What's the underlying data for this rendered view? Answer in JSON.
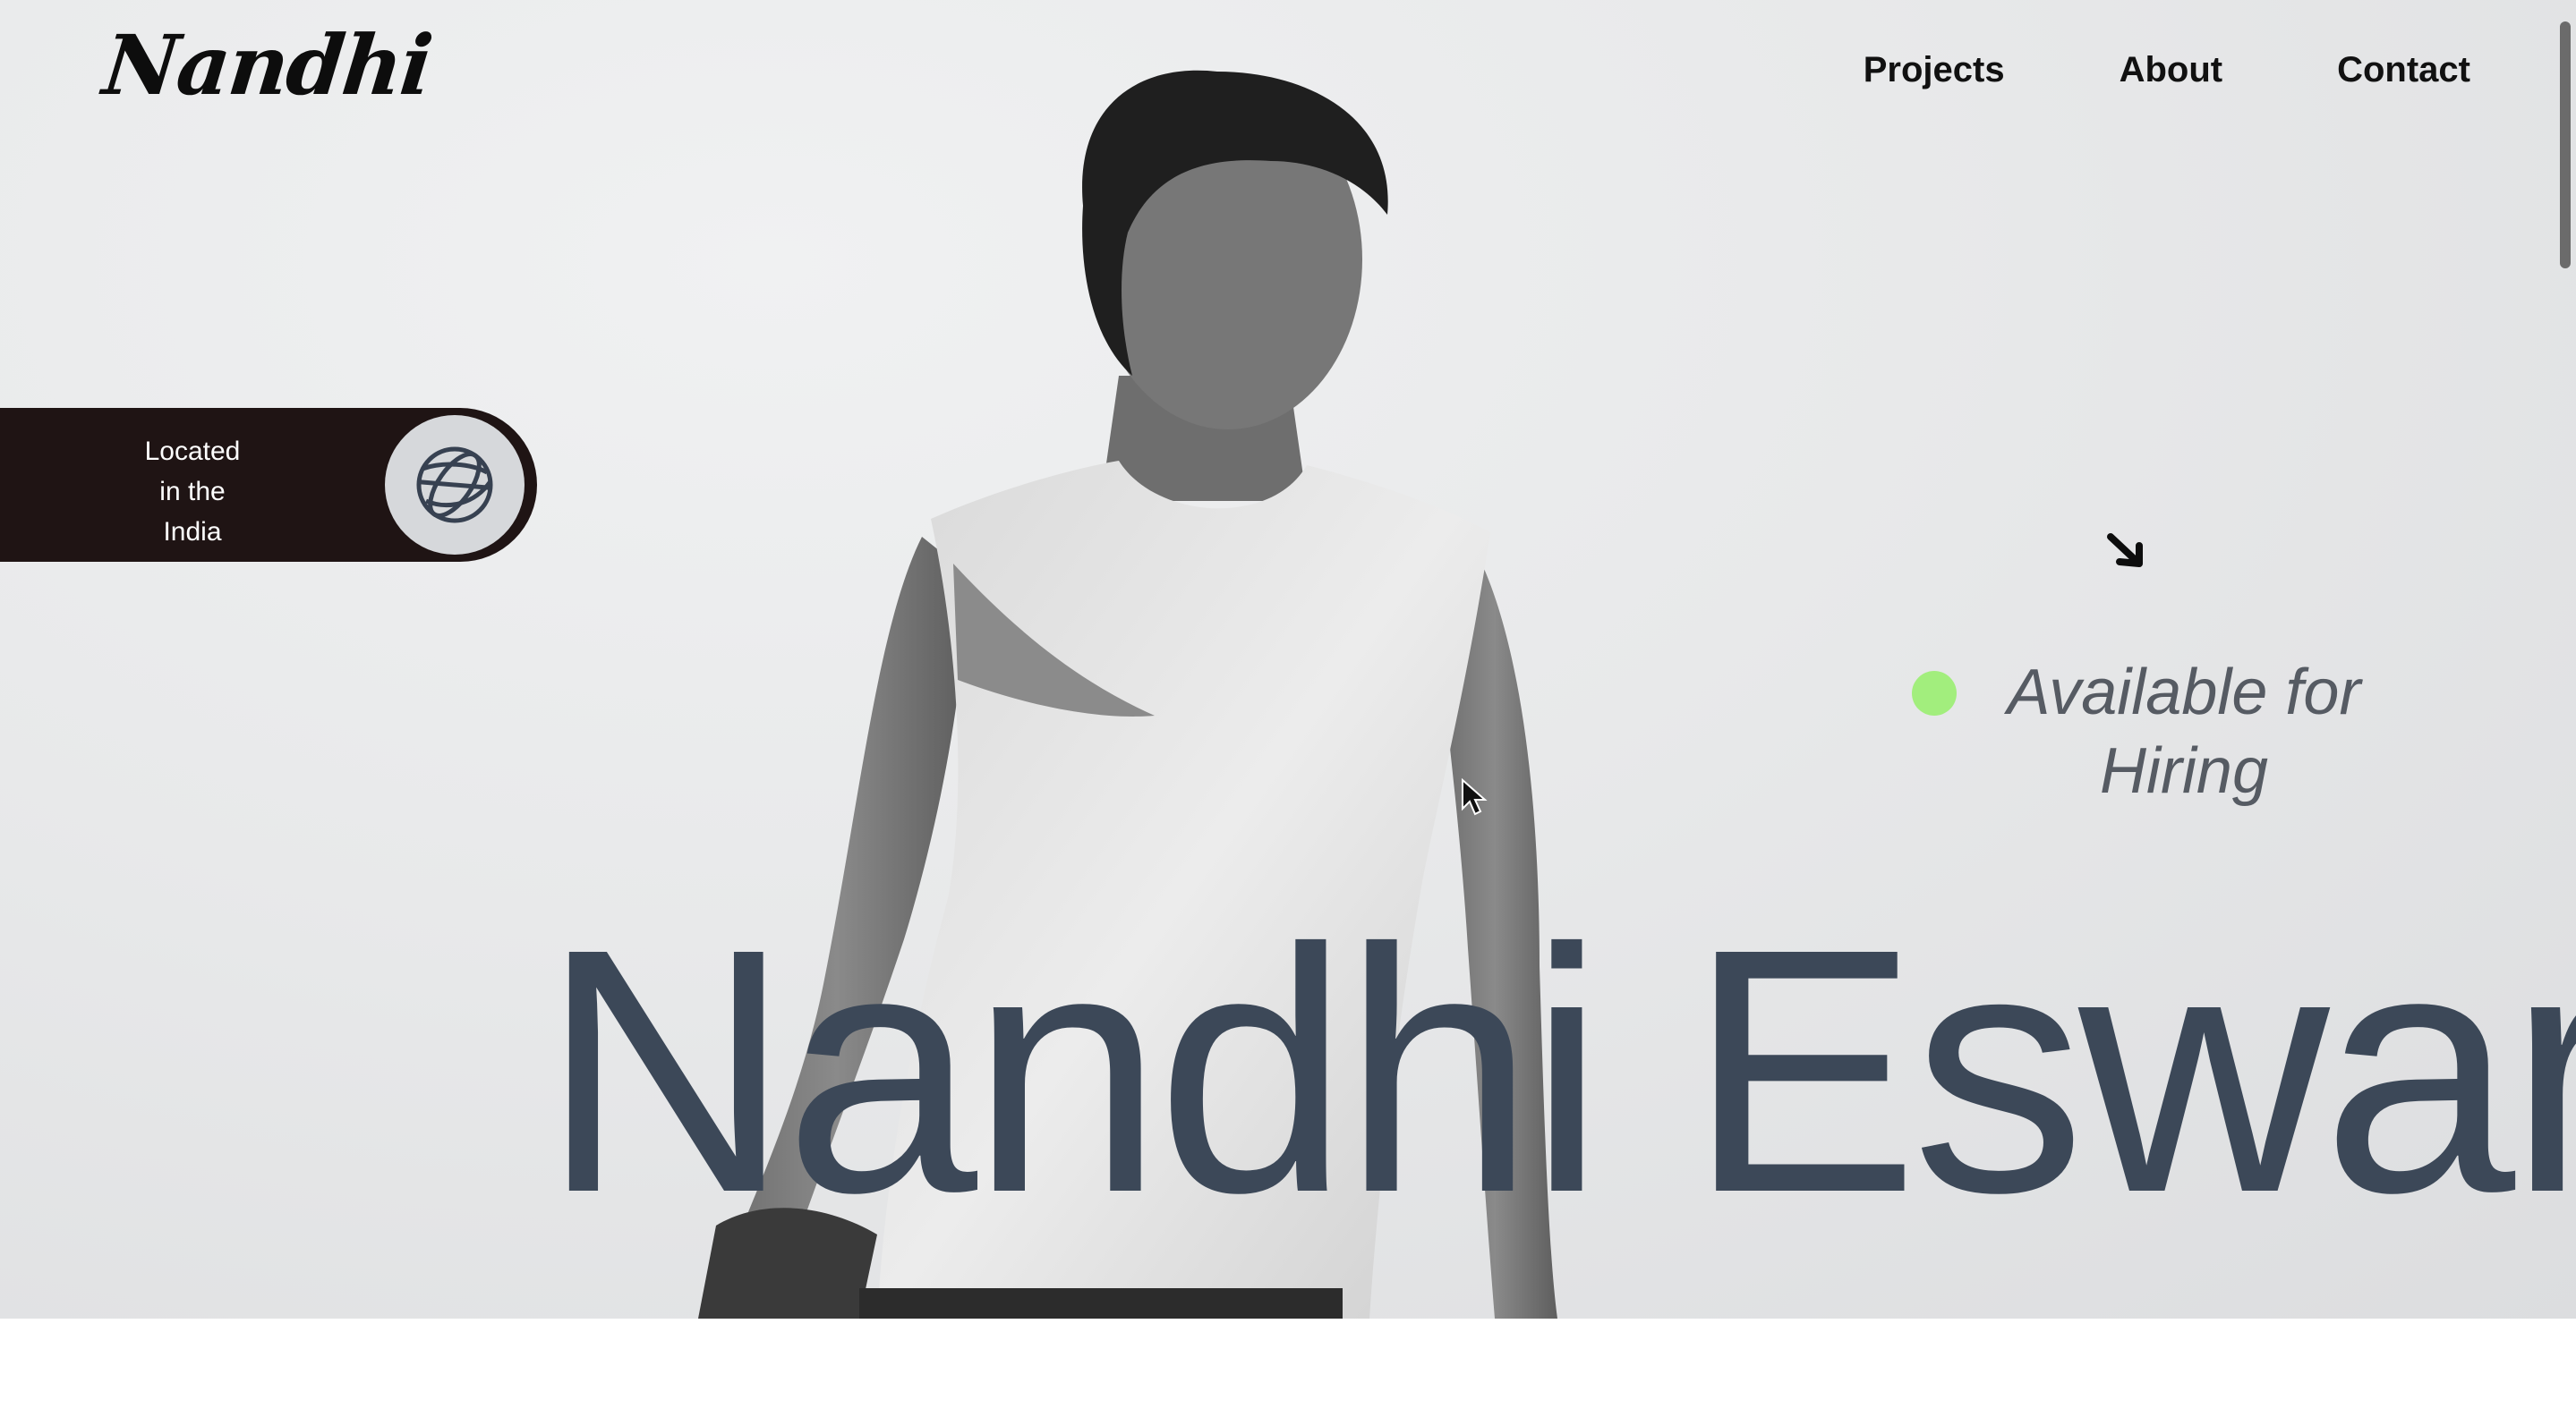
{
  "header": {
    "logo": "Nandhi",
    "nav": [
      {
        "label": "Projects"
      },
      {
        "label": "About"
      },
      {
        "label": "Contact"
      }
    ]
  },
  "location": {
    "line1": "Located",
    "line2": "in the",
    "line3": "India",
    "icon": "globe-icon"
  },
  "availability": {
    "text": "Available for Hiring",
    "status_color": "#a2ee7d"
  },
  "hero": {
    "name": "Nandhi Eswaran",
    "photo": "black-and-white portrait of man in sleeveless shirt"
  },
  "colors": {
    "name_text": "#3c4858",
    "pill_bg": "#1f1414",
    "globe_bg": "#d6d8db",
    "availability_text": "#565b63"
  }
}
